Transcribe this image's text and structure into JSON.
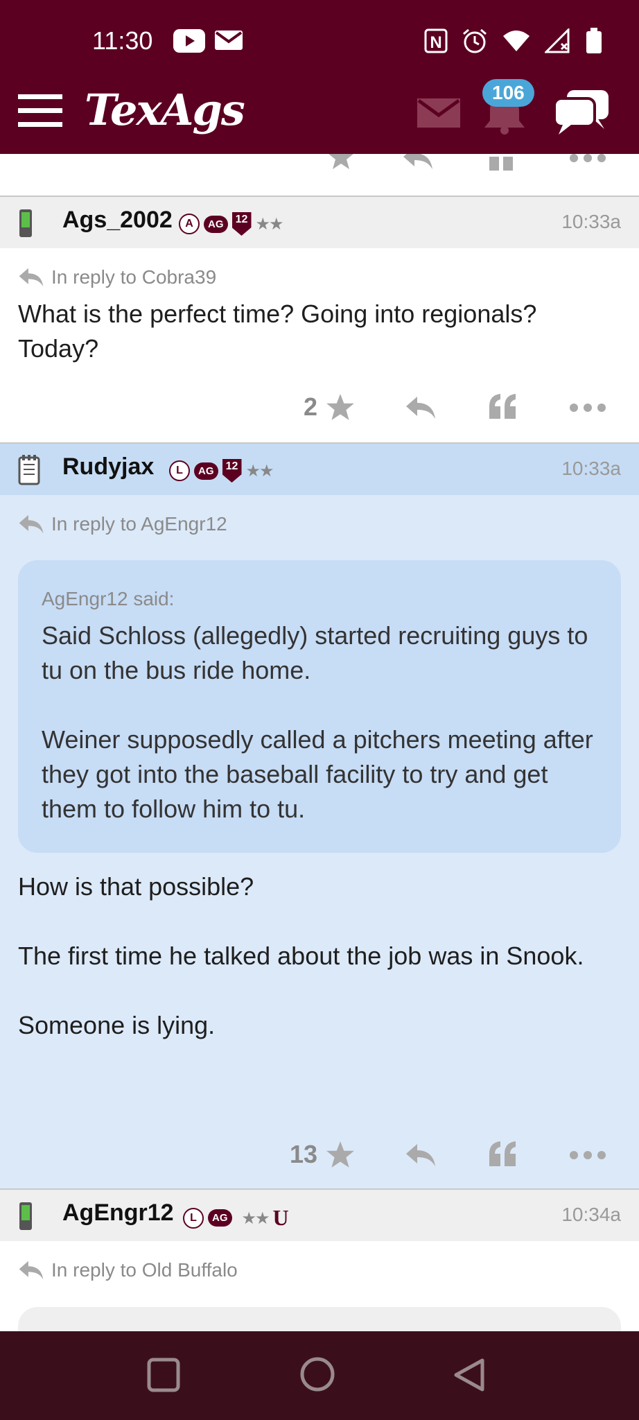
{
  "status_bar": {
    "time": "11:30",
    "left_icons": [
      "youtube-icon",
      "gmail-icon"
    ],
    "right_icons": [
      "nfc-icon",
      "alarm-icon",
      "wifi-icon",
      "signal-icon",
      "battery-icon"
    ]
  },
  "header": {
    "logo": "TexAgs",
    "notification_count": "106",
    "icons": [
      "menu-icon",
      "mail-icon",
      "bell-icon",
      "chat-icon"
    ]
  },
  "posts": [
    {
      "username": "Ags_2002",
      "badges": [
        "A",
        "AG",
        "12",
        "★★"
      ],
      "time": "10:33a",
      "reply_to": "In reply to Cobra39",
      "body": "What is the perfect time? Going into regionals? Today?",
      "likes": "2"
    },
    {
      "username": "Rudyjax",
      "badges": [
        "L",
        "AG",
        "12",
        "★★"
      ],
      "time": "10:33a",
      "reply_to": "In reply to AgEngr12",
      "quote_author": "AgEngr12 said:",
      "quote_p1": "Said Schloss (allegedly) started recruiting guys to tu on the bus ride home.",
      "quote_p2": "Weiner supposedly called a pitchers meeting after they got into the baseball facility to try and get them to follow him to tu.",
      "body_p1": "How is that possible?",
      "body_p2": "The first time he talked about the job was in Snook.",
      "body_p3": "Someone is lying.",
      "likes": "13",
      "highlighted": true
    },
    {
      "username": "AgEngr12",
      "badges": [
        "L",
        "AG",
        "★★",
        "U"
      ],
      "time": "10:34a",
      "reply_to": "In reply to Old Buffalo"
    }
  ],
  "colors": {
    "brand": "#5c0022",
    "highlight_bg": "#dce9f9",
    "badge_blue": "#4aa6d8",
    "nav_bg": "#3a0f1b"
  }
}
